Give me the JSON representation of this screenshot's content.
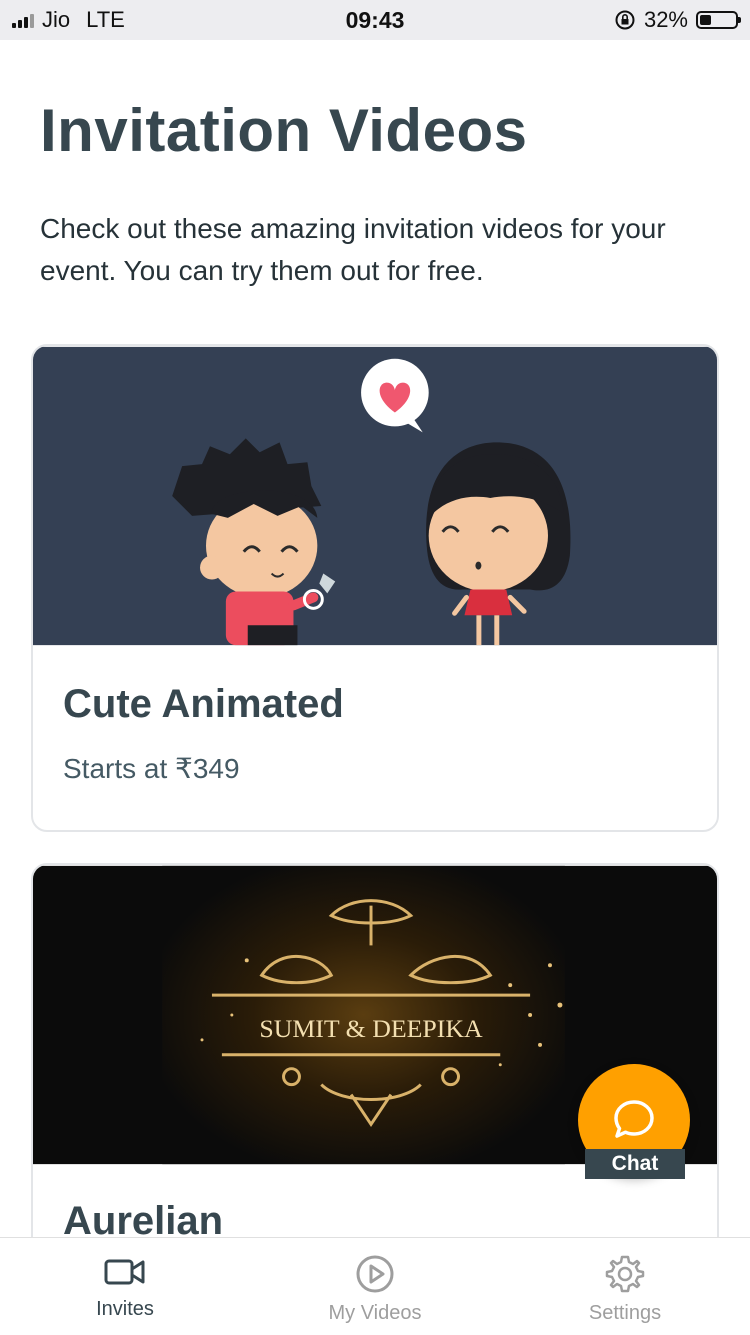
{
  "status": {
    "carrier": "Jio",
    "network": "LTE",
    "time": "09:43",
    "battery_text": "32%",
    "battery_level": 0.32
  },
  "header": {
    "title": "Invitation Videos",
    "subtitle": "Check out these amazing invitation videos for your event. You can try them out for free."
  },
  "cards": [
    {
      "name": "Cute Animated",
      "price": "Starts at ₹349",
      "thumbnail_icon": "couple-proposal-illustration"
    },
    {
      "name": "Aurelian",
      "thumbnail_text": "SUMIT & DEEPIKA",
      "thumbnail_icon": "golden-ornament-frame"
    }
  ],
  "chat": {
    "label": "Chat",
    "icon": "chat-bubble-icon",
    "color": "#ffa000"
  },
  "tabs": [
    {
      "label": "Invites",
      "icon": "video-camera-icon",
      "active": true
    },
    {
      "label": "My Videos",
      "icon": "play-circle-icon",
      "active": false
    },
    {
      "label": "Settings",
      "icon": "gear-icon",
      "active": false
    }
  ],
  "colors": {
    "heading": "#37474f",
    "card_border": "#e3e5e8",
    "thumb_bg_1": "#344054",
    "thumb_bg_2": "#0b0b0b",
    "accent": "#ffa000"
  }
}
